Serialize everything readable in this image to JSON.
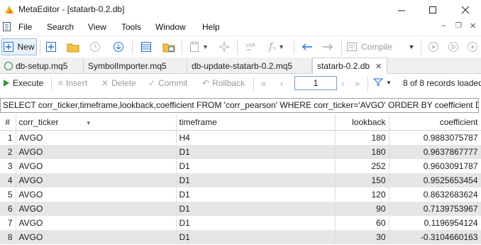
{
  "window": {
    "title": "MetaEditor - [statarb-0.2.db]",
    "colors": {
      "accent": "#1e6fd9",
      "selected_tab": "#ffffff"
    }
  },
  "menu": [
    "File",
    "Search",
    "View",
    "Tools",
    "Window",
    "Help"
  ],
  "toolbar": {
    "new_label": "New",
    "compile_label": "Compile"
  },
  "tabs": [
    {
      "label": "db-setup.mq5",
      "active": false
    },
    {
      "label": "SymbolImporter.mq5",
      "active": false
    },
    {
      "label": "db-update-statarb-0.2.mq5",
      "active": false
    },
    {
      "label": "statarb-0.2.db",
      "active": true
    }
  ],
  "query_toolbar": {
    "execute": "Execute",
    "insert": "Insert",
    "delete": "Delete",
    "commit": "Commit",
    "rollback": "Rollback",
    "page": "1",
    "records": "8 of 8 records loaded"
  },
  "sql": "SELECT corr_ticker,timeframe,lookback,coefficient FROM 'corr_pearson' WHERE corr_ticker='AVGO' ORDER BY coefficient DESC",
  "grid": {
    "columns": [
      "#",
      "corr_ticker",
      "timeframe",
      "lookback",
      "coefficient"
    ],
    "rows": [
      [
        "1",
        "AVGO",
        "H4",
        "180",
        "0.9883075787"
      ],
      [
        "2",
        "AVGO",
        "D1",
        "180",
        "0.9637867777"
      ],
      [
        "3",
        "AVGO",
        "D1",
        "252",
        "0.9603091787"
      ],
      [
        "4",
        "AVGO",
        "D1",
        "150",
        "0.9525653454"
      ],
      [
        "5",
        "AVGO",
        "D1",
        "120",
        "0.8632683624"
      ],
      [
        "6",
        "AVGO",
        "D1",
        "90",
        "0.7139753967"
      ],
      [
        "7",
        "AVGO",
        "D1",
        "60",
        "0.1196954124"
      ],
      [
        "8",
        "AVGO",
        "D1",
        "30",
        "-0.3104660163"
      ]
    ]
  }
}
